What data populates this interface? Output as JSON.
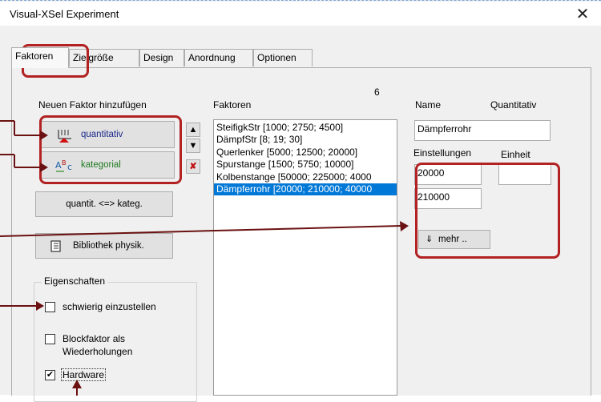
{
  "window": {
    "title": "Visual-XSel  Experiment",
    "close_icon": "✕"
  },
  "tabs": [
    {
      "label": "Faktoren",
      "active": true
    },
    {
      "label": "Zielgröße",
      "active": false
    },
    {
      "label": "Design",
      "active": false
    },
    {
      "label": "Anordnung",
      "active": false
    },
    {
      "label": "Optionen",
      "active": false
    }
  ],
  "left": {
    "add_factor_label": "Neuen Faktor hinzufügen",
    "quantitative_button": "quantitativ",
    "categorical_button": "kategorial",
    "convert_button": "quantit. <=> kateg.",
    "library_button": "Bibliothek physik."
  },
  "properties": {
    "title": "Eigenschaften",
    "difficult_label": "schwierig einzustellen",
    "difficult_checked": false,
    "block_label_line1": "Blockfaktor als",
    "block_label_line2": "Wiederholungen",
    "block_checked": false,
    "hardware_label": "Hardware",
    "hardware_checked": true
  },
  "factors": {
    "count": "6",
    "label": "Faktoren",
    "items": [
      "SteifigkStr [1000; 2750; 4500]",
      "DämpfStr [8; 19; 30]",
      "Querlenker [5000; 12500; 20000]",
      "Spurstange [1500; 5750; 10000]",
      "Kolbenstange [50000; 225000; 4000",
      "Dämpferrohr [20000; 210000; 40000"
    ],
    "selected_index": 5
  },
  "detail": {
    "name_label": "Name",
    "quant_label": "Quantitativ",
    "name_value": "Dämpferrohr",
    "settings_label": "Einstellungen",
    "unit_label": "Einheit",
    "setting1": "20000",
    "setting2": "210000",
    "unit_value": "",
    "more_button": "mehr .."
  },
  "colors": {
    "highlight": "#b22222",
    "selection": "#0078d7"
  }
}
